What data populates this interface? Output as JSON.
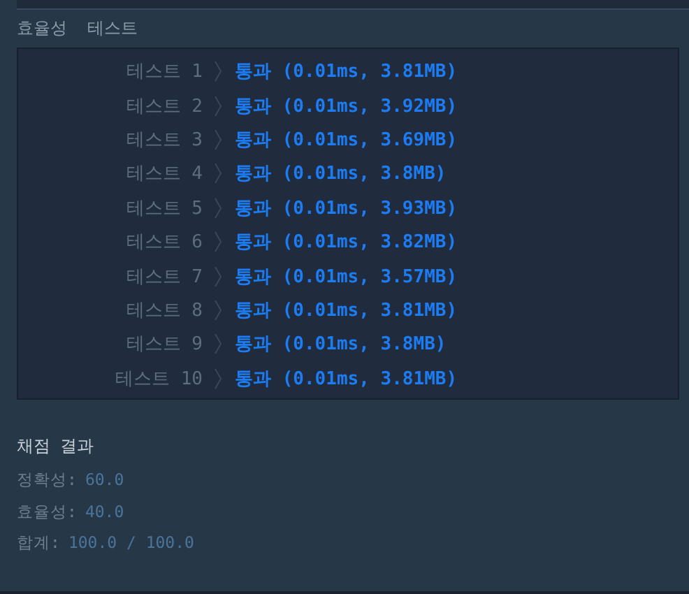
{
  "section_title": "효율성  테스트",
  "tests": [
    {
      "label": "테스트 1",
      "result": "통과 (0.01ms, 3.81MB)"
    },
    {
      "label": "테스트 2",
      "result": "통과 (0.01ms, 3.92MB)"
    },
    {
      "label": "테스트 3",
      "result": "통과 (0.01ms, 3.69MB)"
    },
    {
      "label": "테스트 4",
      "result": "통과 (0.01ms, 3.8MB)"
    },
    {
      "label": "테스트 5",
      "result": "통과 (0.01ms, 3.93MB)"
    },
    {
      "label": "테스트 6",
      "result": "통과 (0.01ms, 3.82MB)"
    },
    {
      "label": "테스트 7",
      "result": "통과 (0.01ms, 3.57MB)"
    },
    {
      "label": "테스트 8",
      "result": "통과 (0.01ms, 3.81MB)"
    },
    {
      "label": "테스트 9",
      "result": "통과 (0.01ms, 3.8MB)"
    },
    {
      "label": "테스트 10",
      "result": "통과 (0.01ms, 3.81MB)"
    }
  ],
  "grading": {
    "title": "채점 결과",
    "scores": [
      {
        "label": "정확성:",
        "value": "60.0"
      },
      {
        "label": "효율성:",
        "value": "40.0"
      },
      {
        "label": "합계:",
        "value": "100.0 / 100.0"
      }
    ]
  }
}
